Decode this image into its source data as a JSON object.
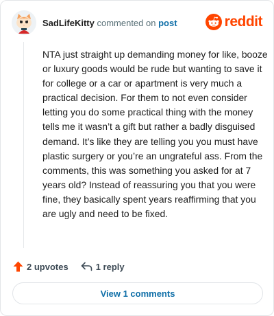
{
  "comment": {
    "author": "SadLifeKitty",
    "action_text": "commented on",
    "target_link": "post",
    "body": "NTA just straight up demanding money for like, booze or luxury goods would be rude but wanting to save it for college or a car or apartment is very much a practical decision. For them to not even consider letting you do some practical thing with the money tells me it wasn’t a gift but rather a badly disguised demand. It’s like they are telling you you must have plastic surgery or you’re an ungrateful ass. From the comments, this was something you asked for at 7 years old? Instead of reassuring you that you were fine, they basically spent years reaffirming that you are ugly and need to be fixed."
  },
  "brand": {
    "name": "reddit",
    "color": "#ff4500"
  },
  "stats": {
    "upvotes_label": "2 upvotes",
    "replies_label": "1 reply"
  },
  "footer": {
    "view_comments_label": "View 1 comments"
  },
  "colors": {
    "upvote": "#ff4500",
    "link": "#0f6fa8"
  },
  "icons": {
    "upvote": "upvote-arrow-icon",
    "reply": "reply-arrow-icon",
    "logo": "reddit-snoo-icon"
  }
}
